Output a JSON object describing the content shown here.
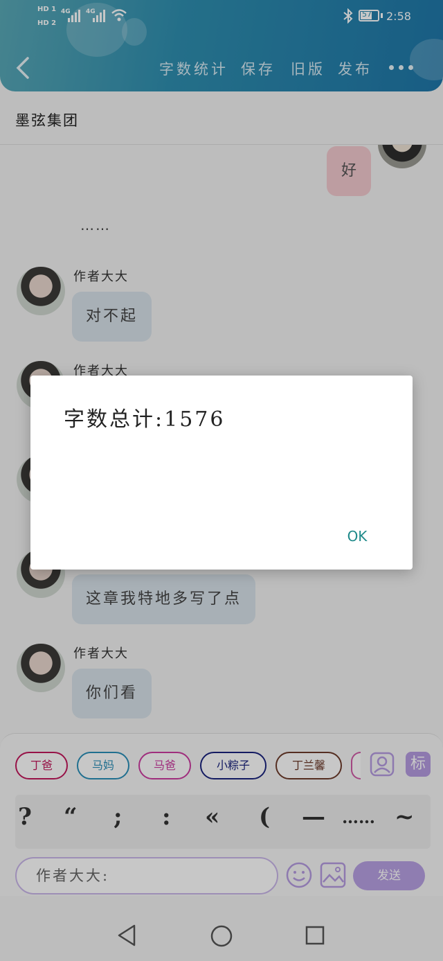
{
  "status_bar": {
    "sim1": "HD 1",
    "sim2": "HD 2",
    "net1": "4G",
    "net2": "4G",
    "battery": "57",
    "time": "2:58"
  },
  "toolbar": {
    "word_count": "字数统计",
    "save": "保存",
    "old_version": "旧版",
    "publish": "发布"
  },
  "group": {
    "name": "墨弦集团"
  },
  "chat": {
    "messages": [
      {
        "text": "好"
      },
      {
        "text": "……"
      },
      {
        "sender": "作者大大",
        "text": "对不起"
      },
      {
        "sender": "作者大大"
      },
      {
        "text": "这章我特地多写了点"
      },
      {
        "sender": "作者大大",
        "text": "你们看"
      }
    ]
  },
  "tags": [
    {
      "label": "丁爸",
      "color": "#c2185b"
    },
    {
      "label": "马妈",
      "color": "#2a8fb8"
    },
    {
      "label": "马爸",
      "color": "#cc3ba0"
    },
    {
      "label": "小粽子",
      "color": "#1a237e"
    },
    {
      "label": "丁兰馨",
      "color": "#6d3b2b"
    }
  ],
  "tools": {
    "biao": "标"
  },
  "punctuation": [
    "?",
    "“",
    ";",
    ":",
    "«",
    "(",
    "—",
    "……",
    "~"
  ],
  "composer": {
    "input_value": "作者大大:",
    "send": "发送"
  },
  "dialog": {
    "message": "字数总计:1576",
    "ok": "OK"
  }
}
